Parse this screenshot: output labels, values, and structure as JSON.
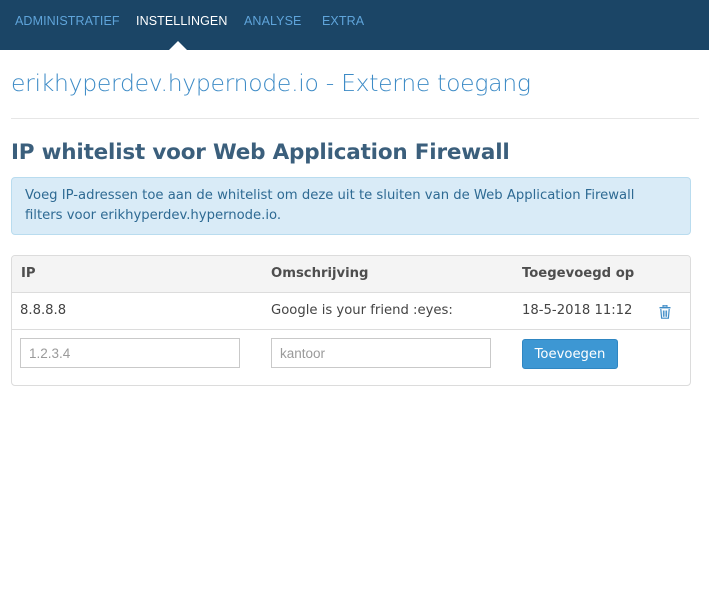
{
  "nav": {
    "items": [
      {
        "label": "ADMINISTRATIEF",
        "active": false
      },
      {
        "label": "INSTELLINGEN",
        "active": true
      },
      {
        "label": "ANALYSE",
        "active": false
      },
      {
        "label": "EXTRA",
        "active": false
      }
    ]
  },
  "page": {
    "title": "erikhyperdev.hypernode.io - Externe toegang"
  },
  "section": {
    "title": "IP whitelist voor Web Application Firewall",
    "info_line1": "Voeg IP-adressen toe aan de whitelist om deze uit te sluiten van de Web Application Firewall",
    "info_line2": "filters voor erikhyperdev.hypernode.io."
  },
  "table": {
    "headers": [
      "IP",
      "Omschrijving",
      "Toegevoegd op"
    ],
    "rows": [
      {
        "ip": "8.8.8.8",
        "description": "Google is your friend :eyes:",
        "added": "18-5-2018 11:12",
        "action_icon": "trash-icon"
      }
    ],
    "new_row": {
      "ip_placeholder": "1.2.3.4",
      "description_placeholder": "kantoor",
      "ip_value": "",
      "description_value": "",
      "submit_label": "Toevoegen"
    }
  },
  "colors": {
    "nav_bg": "#1b4566",
    "nav_link": "#5fa4da",
    "title": "#3d8bc6",
    "button": "#3d97d3",
    "info_bg": "#d9ebf7"
  }
}
